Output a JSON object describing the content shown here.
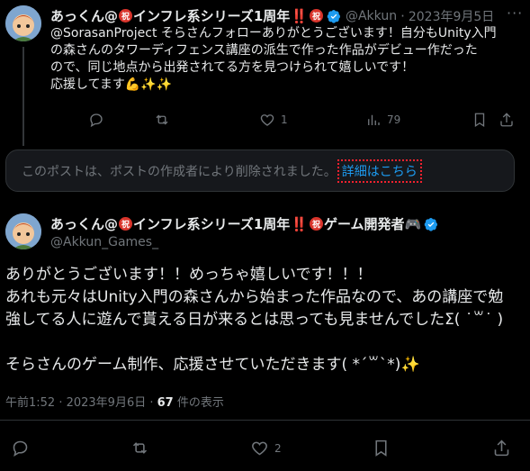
{
  "tweet1": {
    "name_part1": "あっくん@",
    "badge": "祝",
    "name_part2": "インフレ系シリーズ1周年",
    "bang": "‼️",
    "handle": "@Akkun",
    "date": "2023年9月5日",
    "text": "@SorasanProject そらさんフォローありがとうございます！自分もUnity入門\nの森さんのタワーディフェンス講座の派生で作った作品がデビュー作だった\nので、同じ地点から出発されてる方を見つけられて嬉しいです！\n応援してます💪✨✨",
    "likes": "1",
    "views": "79"
  },
  "deleted_notice": {
    "text": "このポストは、ポストの作成者により削除されました。",
    "link": "詳細はこちら"
  },
  "tweet2": {
    "name_part1": "あっくん@",
    "badge": "祝",
    "name_part2": "インフレ系シリーズ1周年",
    "bang": "‼️",
    "name_part3": "ゲーム開発者🎮",
    "handle": "@Akkun_Games_",
    "text": "ありがとうございます！！めっちゃ嬉しいです！！！\nあれも元々はUnity入門の森さんから始まった作品なので、あの講座で勉\n強してる人に遊んで貰える日が来るとは思っても見ませんでしたΣ( ˙꒳˙ )\n\nそらさんのゲーム制作、応援させていただきます( *´꒳`*)✨",
    "time": "午前1:52 · 2023年9月6日 · ",
    "views_count": "67",
    "views_label": " 件の表示",
    "likes": "2"
  },
  "colors": {
    "background": "#000000",
    "text": "#e7e9ea",
    "muted": "#71767b",
    "accent": "#1d9bf0",
    "border": "#2f3336"
  },
  "icons": [
    "more-icon",
    "reply-icon",
    "repost-icon",
    "like-icon",
    "views-icon",
    "bookmark-icon",
    "share-icon",
    "verified-badge-icon"
  ]
}
